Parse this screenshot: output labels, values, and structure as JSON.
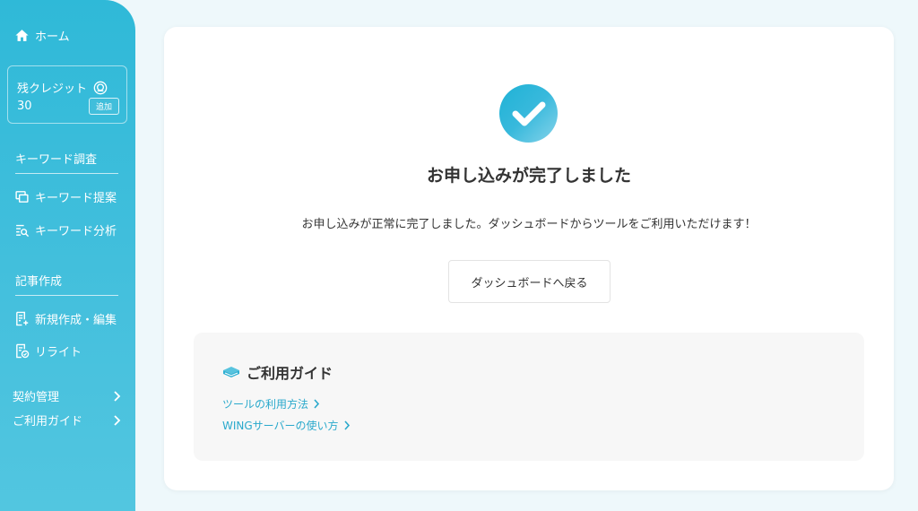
{
  "sidebar": {
    "home_label": "ホーム",
    "credit": {
      "title": "残クレジット",
      "value": "30",
      "add_label": "追加"
    },
    "sections": [
      {
        "heading": "キーワード調査",
        "items": [
          {
            "label": "キーワード提案",
            "icon": "keyword-suggest-icon"
          },
          {
            "label": "キーワード分析",
            "icon": "keyword-analysis-icon"
          }
        ]
      },
      {
        "heading": "記事作成",
        "items": [
          {
            "label": "新規作成・編集",
            "icon": "new-edit-icon"
          },
          {
            "label": "リライト",
            "icon": "rewrite-icon"
          }
        ]
      }
    ],
    "expandables": [
      {
        "label": "契約管理"
      },
      {
        "label": "ご利用ガイド"
      }
    ]
  },
  "main": {
    "title": "お申し込みが完了しました",
    "message": "お申し込みが正常に完了しました。ダッシュボードからツールをご利用いただけます！",
    "dashboard_button": "ダッシュボードへ戻る",
    "guide": {
      "title": "ご利用ガイド",
      "links": [
        {
          "label": "ツールの利用方法"
        },
        {
          "label": "WINGサーバーの使い方"
        }
      ]
    }
  },
  "colors": {
    "accent": "#2fb9d8",
    "link": "#2aa9cc",
    "background": "#eef8fb"
  }
}
